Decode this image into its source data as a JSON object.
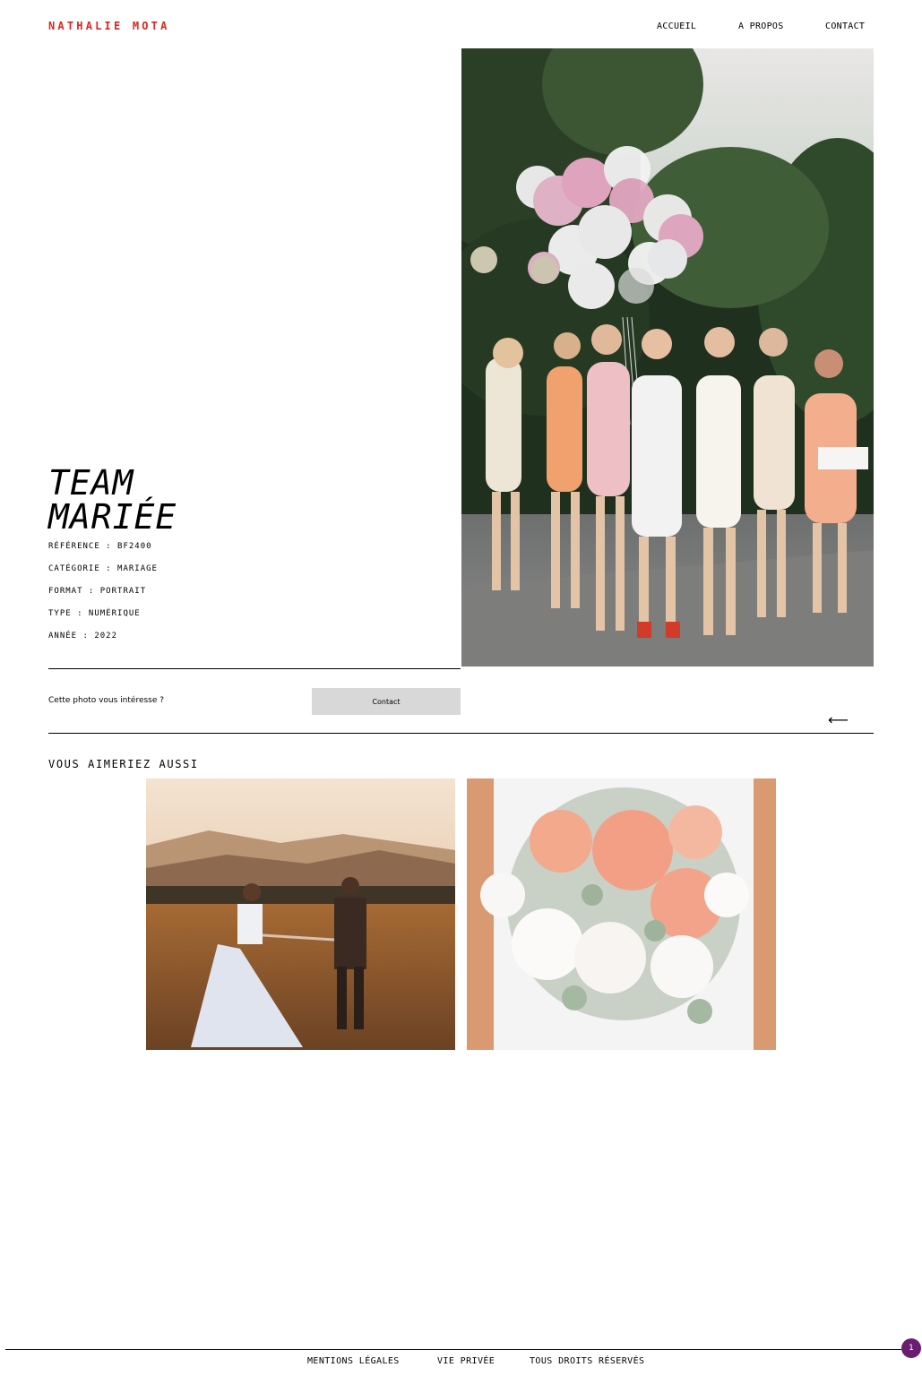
{
  "header": {
    "logo": "NATHALIE MOTA",
    "nav": [
      {
        "label": "ACCUEIL"
      },
      {
        "label": "A PROPOS"
      },
      {
        "label": "CONTACT"
      }
    ]
  },
  "photo": {
    "title_line1": "TEAM",
    "title_line2": "MARIÉE",
    "meta": [
      "RÉFÉRENCE : BF2400",
      "CATÉGORIE : MARIAGE",
      "FORMAT : PORTRAIT",
      "TYPE : NUMÉRIQUE",
      "ANNÉE : 2022"
    ]
  },
  "interest": {
    "question": "Cette photo vous intéresse ?",
    "button_label": "Contact",
    "arrow": "⟵"
  },
  "related": {
    "title": "VOUS AIMERIEZ AUSSI"
  },
  "footer": {
    "links": [
      {
        "label": "MENTIONS LÉGALES"
      },
      {
        "label": "VIE PRIVÉE"
      },
      {
        "label": "TOUS DROITS RÉSERVÉS"
      }
    ]
  },
  "badge": {
    "count": "1"
  },
  "colors": {
    "accent": "#e0231c",
    "badge": "#6b1d6f",
    "button_bg": "#d8d8d8"
  }
}
